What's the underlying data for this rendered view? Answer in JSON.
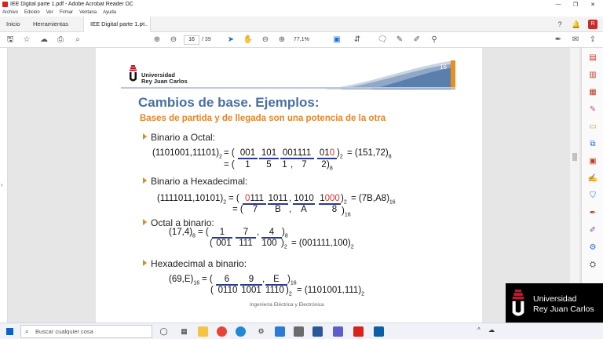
{
  "window": {
    "title": "IEE Digital parte 1.pdf - Adobe Acrobat Reader DC",
    "controls": [
      "—",
      "❐",
      "✕"
    ]
  },
  "menu": [
    "Archivo",
    "Edición",
    "Ver",
    "Firmar",
    "Ventana",
    "Ayuda"
  ],
  "tabs": {
    "home": "Inicio",
    "tools": "Herramientas",
    "document": "IEE Digital parte 1.p...",
    "document_close": "×"
  },
  "toolbar": {
    "page_current": "16",
    "page_total": "/ 39",
    "zoom": "77,1%"
  },
  "slide": {
    "page_number": "16",
    "university_line1": "Universidad",
    "university_line2": "Rey Juan Carlos",
    "title": "Cambios de base. Ejemplos:",
    "subtitle": "Bases de partida y de llegada son una potencia de la otra",
    "bullet1": "Binario a Octal:",
    "bullet2": "Binario a Hexadecimal:",
    "bullet3": "Octal a binario:",
    "bullet4": "Hexadecimal a binario:",
    "footer": "Ingeniería Eléctrica y Electrónica",
    "oct": {
      "lhs": "(1101001,11101)",
      "lhs_sub": "2",
      "eq_open": "= (",
      "g1": "001",
      "g2": "101",
      "g3": "001",
      "comma": ",",
      "g4": "111",
      "g5a": "01",
      "g5b": "0",
      "close_sub": "2",
      "result": "= (151,72)",
      "result_sub": "8",
      "d1": "1",
      "d2": "5",
      "d3": "1",
      "d4": "7",
      "d5": "2",
      "d_close": ")",
      "d_sub": "8"
    },
    "hex": {
      "lhs": "(1111011,10101)",
      "lhs_sub": "2",
      "eq_open": "= (",
      "g1a": "0",
      "g1b": "111",
      "g2": "1011",
      "comma": ",",
      "g3": "1010",
      "g4a": "1",
      "g4b": "000",
      "close_sub": "2",
      "result": "= (7B,A8)",
      "result_sub": "16",
      "d1": "7",
      "d2": "B",
      "d3": "A",
      "d4": "8",
      "d_open": "= (",
      "d_close": ")",
      "d_sub": "16"
    },
    "o2b": {
      "lhs": "(17,4)",
      "lhs_sub": "8",
      "eq_open": "= (",
      "d1": "1",
      "d2": "7",
      "comma": ",",
      "d3": "4",
      "d_sub": "8",
      "b_open": "(",
      "b1": "001",
      "b2": "111",
      "b3": "100",
      "b_sub": "2",
      "result": "= (001111,100)",
      "result_sub": "2"
    },
    "h2b": {
      "lhs": "(69,E)",
      "lhs_sub": "16",
      "eq_open": "= (",
      "d1": "6",
      "d2": "9",
      "comma": ",",
      "d3": "E",
      "d_sub": "16",
      "b_open": "(",
      "b1": "0110",
      "b2": "1001",
      "b3": "1110",
      "b_sub": "2",
      "result": "= (1101001,111)",
      "result_sub": "2"
    }
  },
  "watermark": {
    "line1": "Universidad",
    "line2": "Rey Juan Carlos"
  },
  "taskbar": {
    "search_placeholder": "Buscar cualquier cosa"
  },
  "colors": {
    "accent_orange": "#e98d27",
    "title_blue": "#4a6fa0",
    "underline_blue": "#2b3a8f",
    "highlight_red": "#d4332a"
  }
}
